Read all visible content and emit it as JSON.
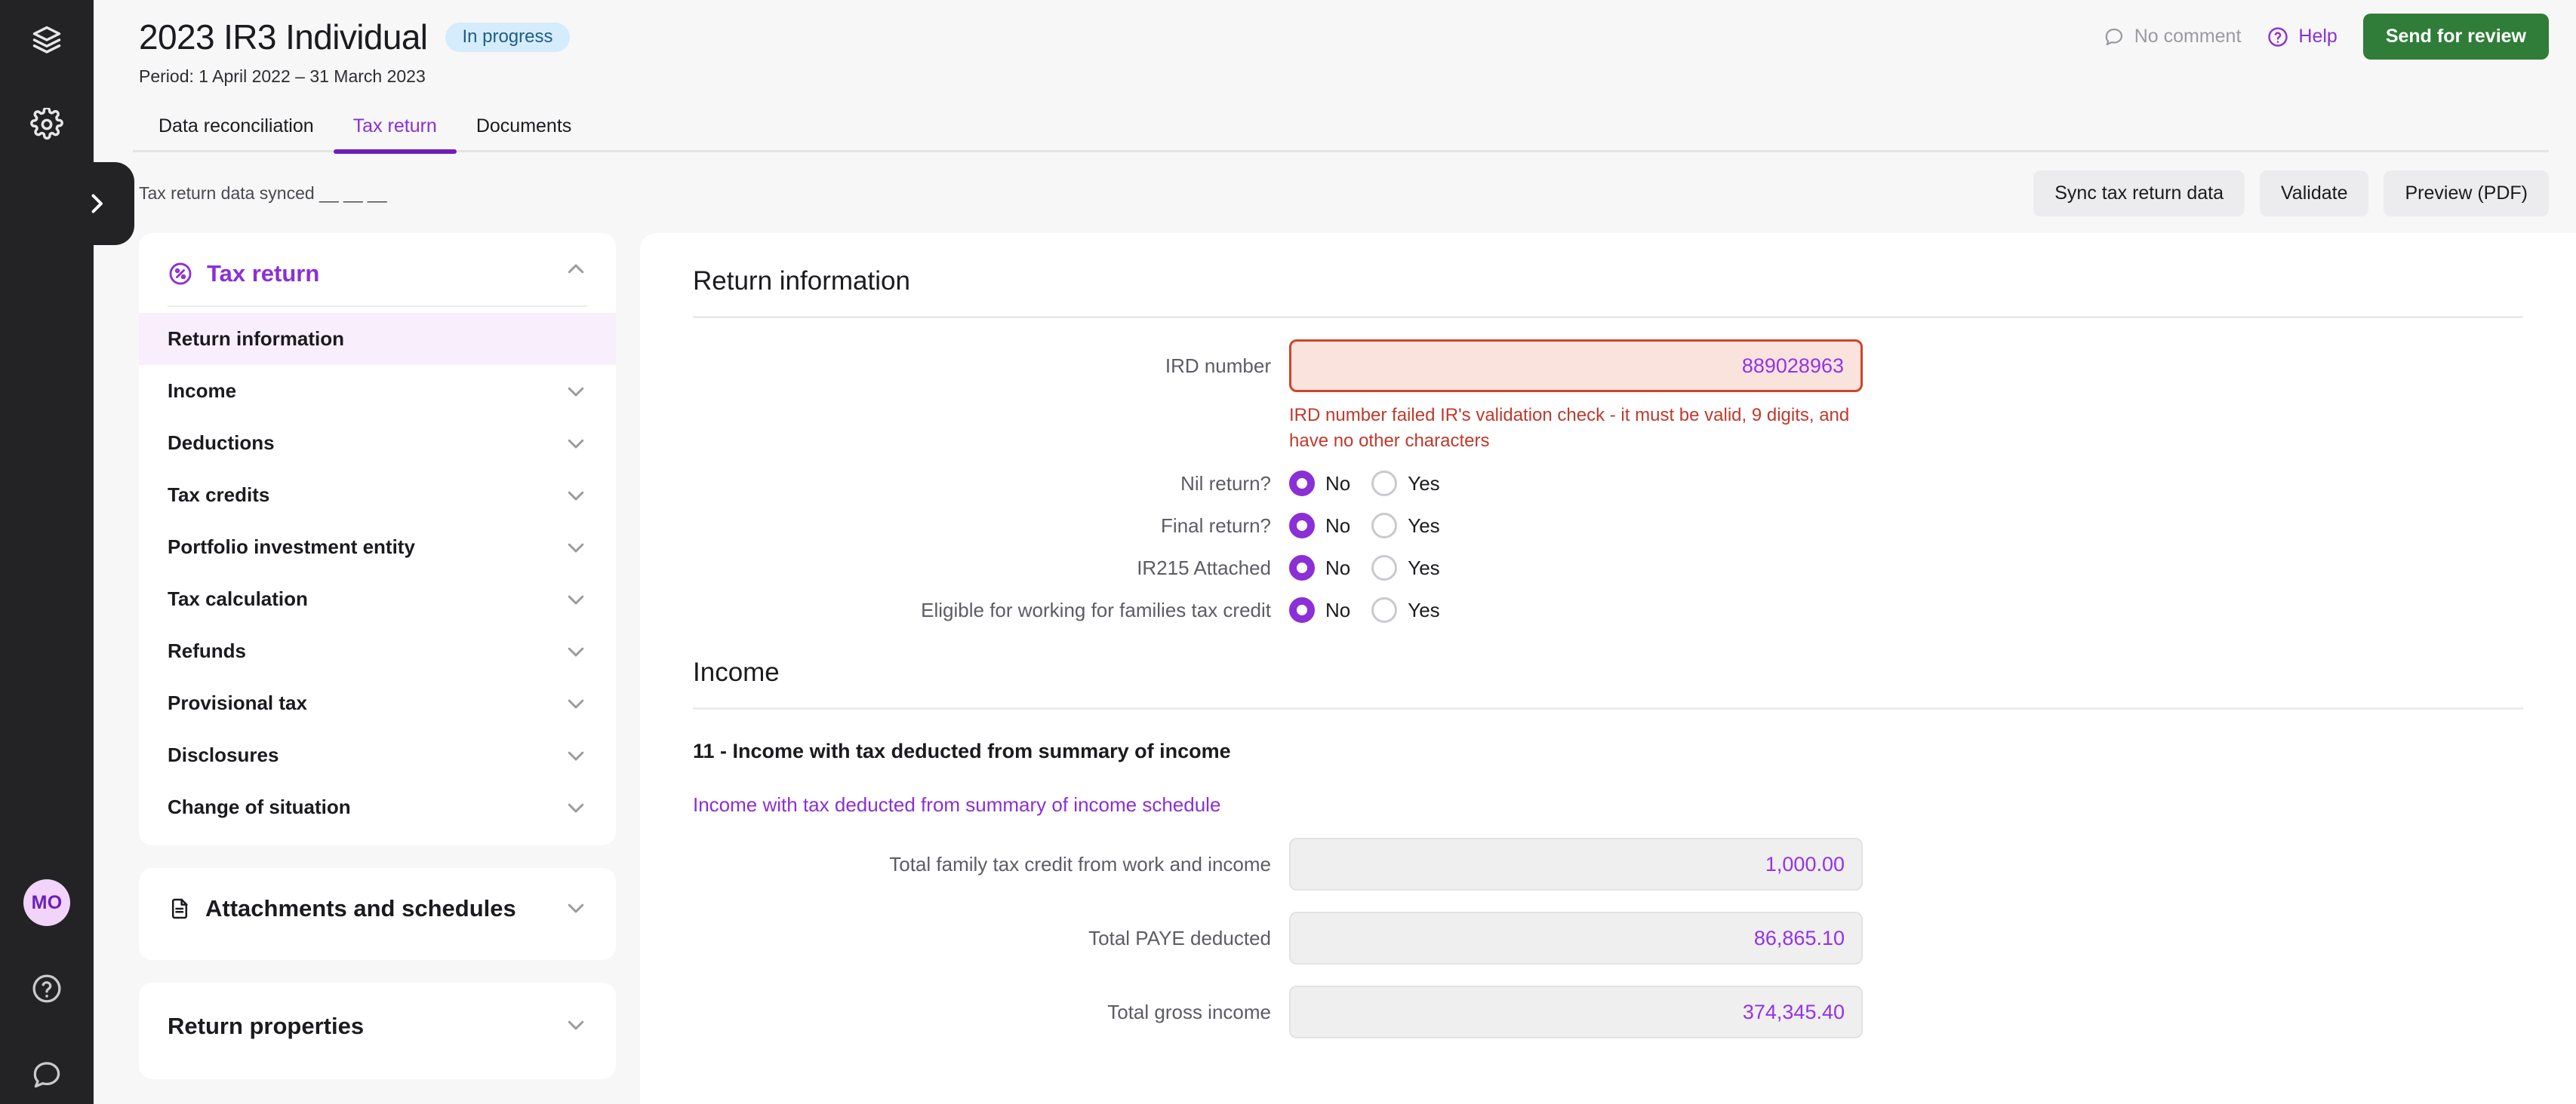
{
  "rail": {
    "logo_icon": "layers-icon",
    "settings_icon": "gear-icon",
    "expander_icon": "chevron-right-icon",
    "avatar_initials": "MO",
    "help_icon": "help-circle-icon",
    "chat_icon": "chat-bubble-icon"
  },
  "header": {
    "title": "2023 IR3 Individual",
    "status": "In progress",
    "period": "Period: 1 April 2022 – 31 March 2023",
    "comment_label": "No comment",
    "comment_icon": "comment-icon",
    "help_label": "Help",
    "help_icon": "help-circle-icon",
    "send_for_review": "Send for review"
  },
  "tabs": [
    {
      "label": "Data reconciliation",
      "active": false
    },
    {
      "label": "Tax return",
      "active": true
    },
    {
      "label": "Documents",
      "active": false
    }
  ],
  "toolbar": {
    "sync_text": "Tax return data synced __ __ __",
    "sync_button": "Sync tax return data",
    "validate_button": "Validate",
    "preview_button": "Preview (PDF)"
  },
  "sidebar": {
    "tax_return": {
      "title": "Tax return",
      "icon": "percent-circle-icon",
      "collapse_icon": "chevron-up-icon",
      "items": [
        {
          "label": "Return information",
          "active": true,
          "has_chevron": false
        },
        {
          "label": "Income",
          "active": false,
          "has_chevron": true
        },
        {
          "label": "Deductions",
          "active": false,
          "has_chevron": true
        },
        {
          "label": "Tax credits",
          "active": false,
          "has_chevron": true
        },
        {
          "label": "Portfolio investment entity",
          "active": false,
          "has_chevron": true
        },
        {
          "label": "Tax calculation",
          "active": false,
          "has_chevron": true
        },
        {
          "label": "Refunds",
          "active": false,
          "has_chevron": true
        },
        {
          "label": "Provisional tax",
          "active": false,
          "has_chevron": true
        },
        {
          "label": "Disclosures",
          "active": false,
          "has_chevron": true
        },
        {
          "label": "Change of situation",
          "active": false,
          "has_chevron": true
        }
      ]
    },
    "attachments": {
      "title": "Attachments and schedules",
      "icon": "document-icon",
      "collapse_icon": "chevron-down-icon"
    },
    "return_properties": {
      "title": "Return properties",
      "collapse_icon": "chevron-down-icon"
    }
  },
  "main": {
    "return_information": {
      "heading": "Return information",
      "ird": {
        "label": "IRD number",
        "value": "889028963",
        "error": "IRD number failed IR's validation check - it must be valid, 9 digits, and have no other characters"
      },
      "radios": [
        {
          "label": "Nil return?",
          "options": [
            "No",
            "Yes"
          ],
          "selected": "No"
        },
        {
          "label": "Final return?",
          "options": [
            "No",
            "Yes"
          ],
          "selected": "No"
        },
        {
          "label": "IR215 Attached",
          "options": [
            "No",
            "Yes"
          ],
          "selected": "No"
        },
        {
          "label": "Eligible for working for families tax credit",
          "options": [
            "No",
            "Yes"
          ],
          "selected": "No"
        }
      ]
    },
    "income": {
      "heading": "Income",
      "subsection": "11 - Income with tax deducted from summary of income",
      "schedule_link": "Income with tax deducted from summary of income schedule",
      "fields": [
        {
          "label": "Total family tax credit from work and income",
          "value": "1,000.00"
        },
        {
          "label": "Total PAYE deducted",
          "value": "86,865.10"
        },
        {
          "label": "Total gross income",
          "value": "374,345.40"
        }
      ]
    }
  },
  "colors": {
    "accent_purple": "#8b2fd6",
    "value_purple": "#9333ea",
    "green_button": "#2f7d38",
    "error_red": "#c0392b",
    "badge_blue_bg": "#d4ecfb",
    "badge_blue_text": "#1f5c8b"
  }
}
